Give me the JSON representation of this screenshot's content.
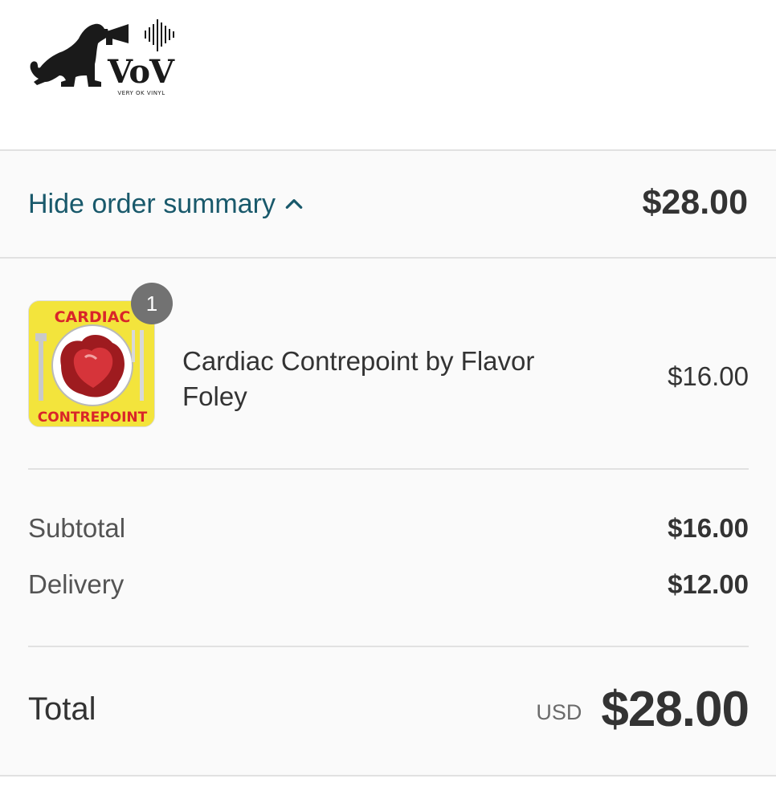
{
  "brand": {
    "wordmark": "VoV",
    "tagline": "VERY OK VINYL"
  },
  "summary_toggle": {
    "label": "Hide order summary",
    "icon": "chevron-up-icon",
    "total": "$28.00"
  },
  "line_items": [
    {
      "title": "Cardiac Contrepoint by Flavor Foley",
      "quantity": "1",
      "price": "$16.00",
      "image_text_top": "CARDIAC",
      "image_text_bottom": "CONTREPOINT"
    }
  ],
  "costs": {
    "subtotal_label": "Subtotal",
    "subtotal_value": "$16.00",
    "delivery_label": "Delivery",
    "delivery_value": "$12.00"
  },
  "total": {
    "label": "Total",
    "currency": "USD",
    "value": "$28.00"
  },
  "colors": {
    "link": "#19596b",
    "panel_bg": "#fafafa",
    "border": "#e1e1e1",
    "badge": "#727272"
  }
}
